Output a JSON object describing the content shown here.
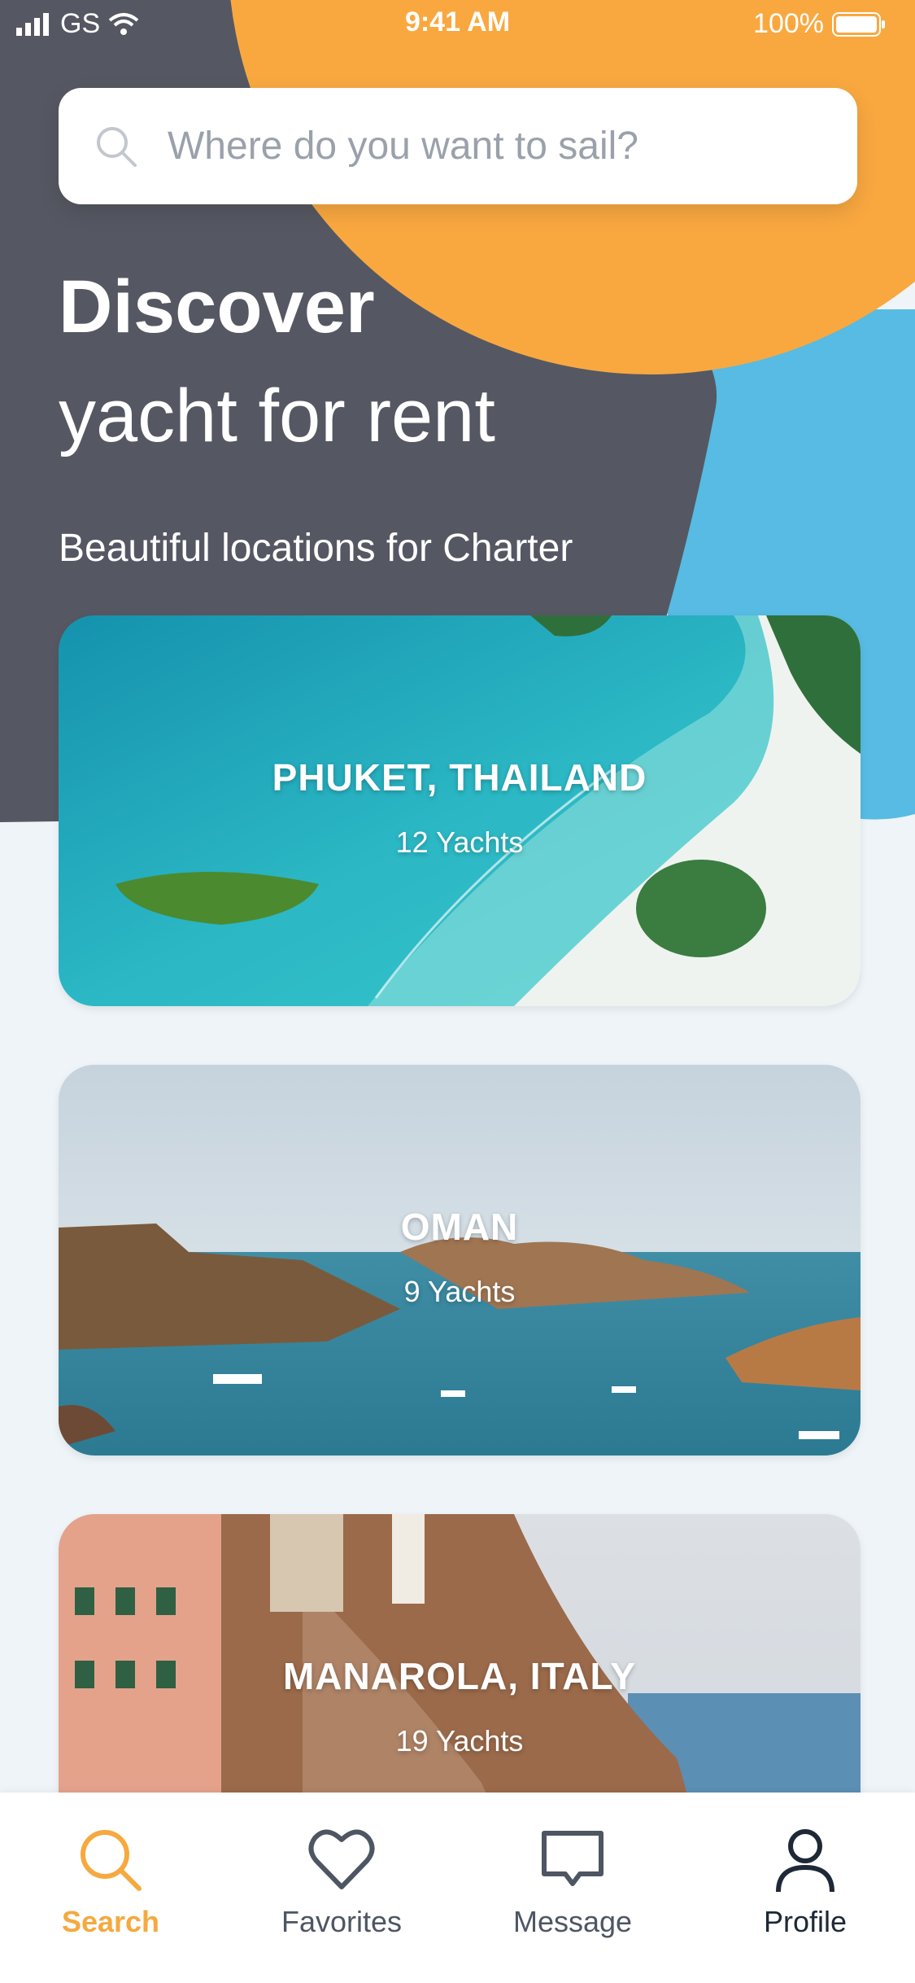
{
  "status_bar": {
    "carrier": "GS",
    "time": "9:41 AM",
    "battery": "100%"
  },
  "search": {
    "placeholder": "Where do you want to sail?",
    "value": ""
  },
  "hero": {
    "title_line1": "Discover",
    "title_line2": "yacht for rent",
    "subtitle": "Beautiful locations for Charter"
  },
  "locations": [
    {
      "name": "PHUKET, THAILAND",
      "count": "12 Yachts"
    },
    {
      "name": "OMAN",
      "count": "9 Yachts"
    },
    {
      "name": "MANAROLA, ITALY",
      "count": "19 Yachts"
    }
  ],
  "tabs": [
    {
      "label": "Search",
      "icon": "search-icon",
      "active": true
    },
    {
      "label": "Favorites",
      "icon": "heart-icon",
      "active": false
    },
    {
      "label": "Message",
      "icon": "message-icon",
      "active": false
    },
    {
      "label": "Profile",
      "icon": "profile-icon",
      "active": false
    }
  ],
  "colors": {
    "dark_bg": "#555862",
    "orange": "#f9a840",
    "blue": "#57bbe3",
    "light_bg": "#eef4f8",
    "active_tab": "#f5a93f"
  }
}
